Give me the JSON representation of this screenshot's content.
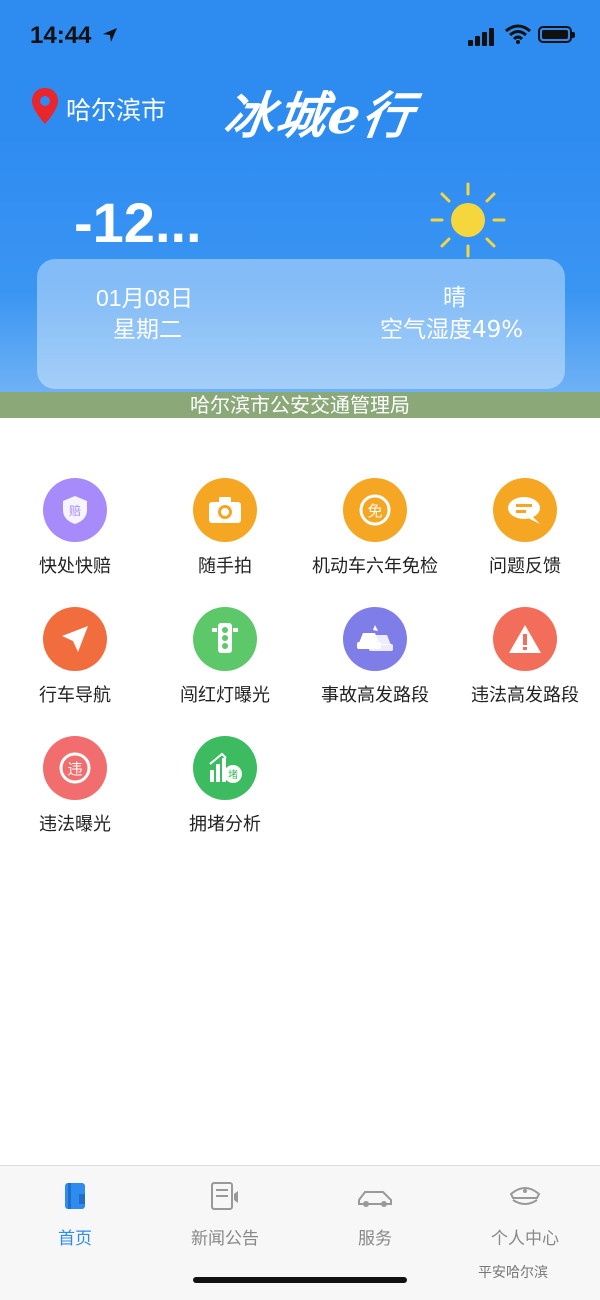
{
  "status": {
    "time": "14:44"
  },
  "header": {
    "city": "哈尔滨市",
    "brand": "冰城e行"
  },
  "weather": {
    "temperature": "-12...",
    "date": "01月08日",
    "weekday": "星期二",
    "condition": "晴",
    "humidity": "空气湿度49%",
    "agency": "哈尔滨市公安交通管理局"
  },
  "services": [
    {
      "label": "快处快赔",
      "icon": "compensation-shield-icon",
      "color": "#a78bfa"
    },
    {
      "label": "随手拍",
      "icon": "camera-icon",
      "color": "#f5a623"
    },
    {
      "label": "机动车六年免检",
      "icon": "inspection-exempt-icon",
      "color": "#f5a623"
    },
    {
      "label": "问题反馈",
      "icon": "feedback-chat-icon",
      "color": "#f5a623"
    },
    {
      "label": "行车导航",
      "icon": "navigation-arrow-icon",
      "color": "#f26d3d"
    },
    {
      "label": "闯红灯曝光",
      "icon": "traffic-light-icon",
      "color": "#5cc86a"
    },
    {
      "label": "事故高发路段",
      "icon": "car-accident-icon",
      "color": "#7f7ee8"
    },
    {
      "label": "违法高发路段",
      "icon": "warning-triangle-icon",
      "color": "#f26d5a"
    },
    {
      "label": "违法曝光",
      "icon": "violation-icon",
      "color": "#f26d6d"
    },
    {
      "label": "拥堵分析",
      "icon": "congestion-chart-icon",
      "color": "#3dbb61"
    }
  ],
  "tabs": [
    {
      "label": "首页",
      "icon": "home-book-icon",
      "active": true
    },
    {
      "label": "新闻公告",
      "icon": "news-announcement-icon",
      "active": false
    },
    {
      "label": "服务",
      "icon": "car-service-icon",
      "active": false
    },
    {
      "label": "个人中心",
      "icon": "police-cap-icon",
      "active": false
    }
  ],
  "watermark": "平安哈尔滨",
  "colors": {
    "primary": "#2e8bf0",
    "agency_bar": "#8aa878"
  }
}
